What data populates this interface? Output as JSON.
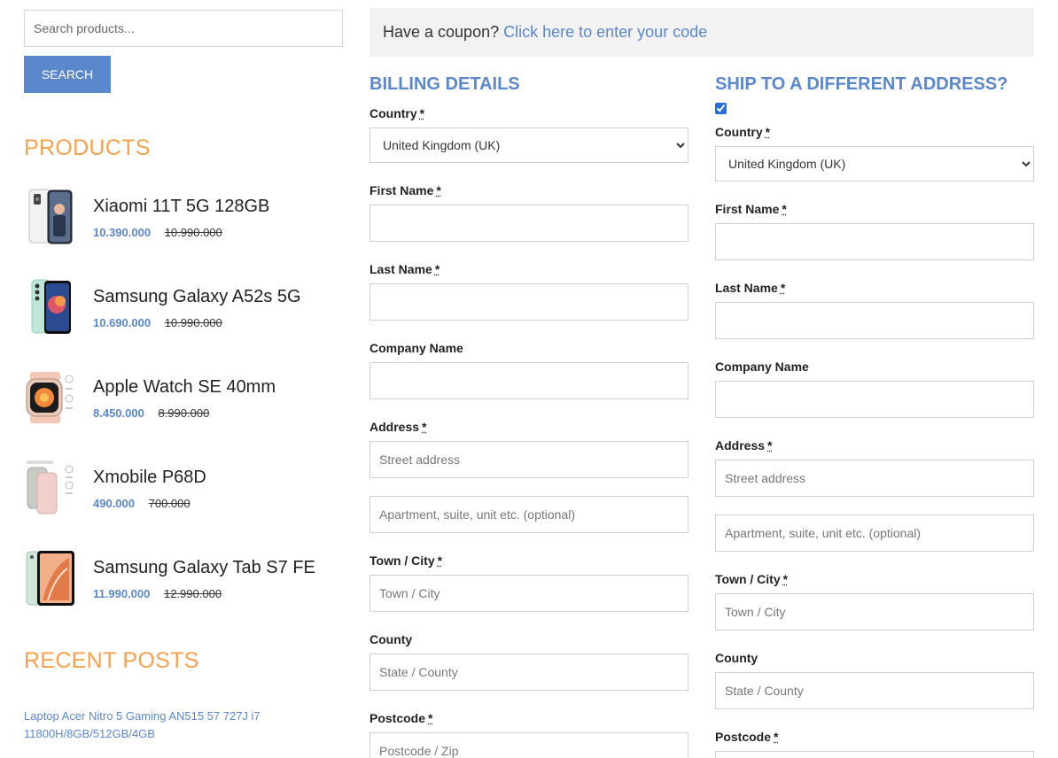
{
  "sidebar": {
    "search_placeholder": "Search products...",
    "search_button": "SEARCH",
    "products_title": "PRODUCTS",
    "products": [
      {
        "name": "Xiaomi 11T 5G 128GB",
        "price": "10.390.000",
        "old_price": "10.990.000",
        "icon": "phone-icon"
      },
      {
        "name": "Samsung Galaxy A52s 5G",
        "price": "10.690.000",
        "old_price": "10.990.000",
        "icon": "phone-icon"
      },
      {
        "name": "Apple Watch SE 40mm",
        "price": "8.450.000",
        "old_price": "8.990.000",
        "icon": "watch-icon"
      },
      {
        "name": "Xmobile P68D",
        "price": "490.000",
        "old_price": "700.000",
        "icon": "powerbank-icon"
      },
      {
        "name": "Samsung Galaxy Tab S7 FE",
        "price": "11.990.000",
        "old_price": "12.990.000",
        "icon": "tablet-icon"
      }
    ],
    "recent_posts_title": "RECENT POSTS",
    "recent_posts": [
      "Laptop Acer Nitro 5 Gaming AN515 57 727J i7 11800H/8GB/512GB/4GB"
    ]
  },
  "coupon": {
    "text": "Have a coupon?",
    "link": "Click here to enter your code"
  },
  "billing": {
    "title": "BILLING DETAILS",
    "country_label": "Country",
    "country_value": "United Kingdom (UK)",
    "first_name_label": "First Name",
    "last_name_label": "Last Name",
    "company_label": "Company Name",
    "address_label": "Address",
    "street_placeholder": "Street address",
    "apartment_placeholder": "Apartment, suite, unit etc. (optional)",
    "city_label": "Town / City",
    "city_placeholder": "Town / City",
    "county_label": "County",
    "county_placeholder": "State / County",
    "postcode_label": "Postcode",
    "postcode_placeholder": "Postcode / Zip"
  },
  "shipping": {
    "title": "SHIP TO A DIFFERENT ADDRESS?",
    "checked": true,
    "country_label": "Country",
    "country_value": "United Kingdom (UK)",
    "first_name_label": "First Name",
    "last_name_label": "Last Name",
    "company_label": "Company Name",
    "address_label": "Address",
    "street_placeholder": "Street address",
    "apartment_placeholder": "Apartment, suite, unit etc. (optional)",
    "city_label": "Town / City",
    "city_placeholder": "Town / City",
    "county_label": "County",
    "county_placeholder": "State / County",
    "postcode_label": "Postcode"
  },
  "required_marker": "*",
  "colors": {
    "accent_blue": "#5b87cc",
    "accent_orange": "#f7a14e",
    "coupon_bg": "#f2f2f2"
  }
}
